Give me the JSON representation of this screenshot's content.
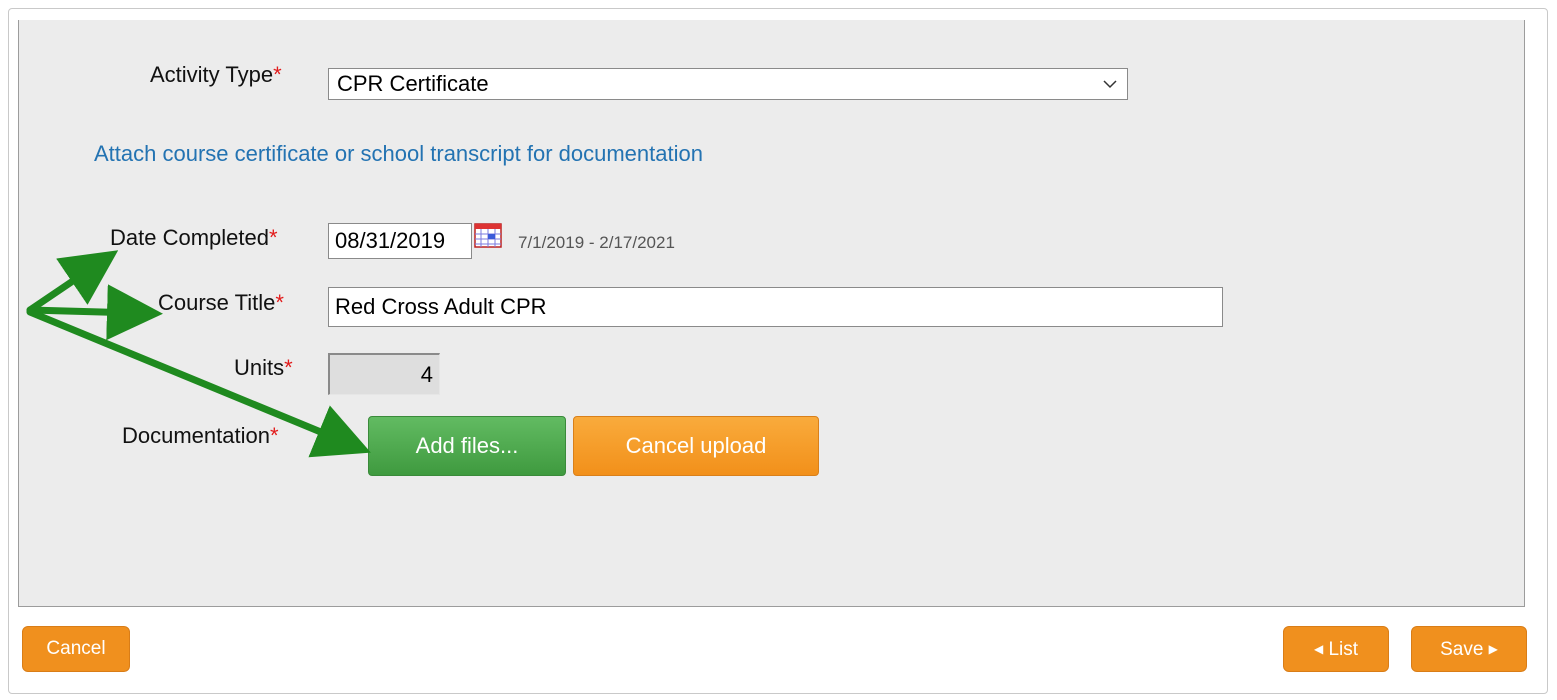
{
  "form": {
    "activity_type": {
      "label": "Activity Type",
      "required_mark": "*",
      "value": "CPR Certificate"
    },
    "help_text": "Attach course certificate or school transcript for documentation",
    "date_completed": {
      "label": "Date Completed",
      "required_mark": "*",
      "value": "08/31/2019",
      "range_hint": "7/1/2019 - 2/17/2021"
    },
    "course_title": {
      "label": "Course Title",
      "required_mark": "*",
      "value": "Red Cross Adult CPR"
    },
    "units": {
      "label": "Units",
      "required_mark": "*",
      "value": "4"
    },
    "documentation": {
      "label": "Documentation",
      "required_mark": "*",
      "add_files_label": "Add files...",
      "cancel_upload_label": "Cancel upload"
    }
  },
  "footer": {
    "cancel_label": "Cancel",
    "list_label": "List",
    "save_label": "Save"
  },
  "icons": {
    "select_chevron": "chevron-down-icon",
    "calendar": "calendar-icon",
    "list_arrow": "triangle-left-icon",
    "save_arrow": "triangle-right-icon",
    "annotation": "green-arrow-annotation"
  },
  "colors": {
    "required": "#e21b1b",
    "link": "#2373b2",
    "add_button": "#4caf50",
    "orange_button": "#f0901e",
    "annotation_arrow": "#1f8a1f"
  }
}
